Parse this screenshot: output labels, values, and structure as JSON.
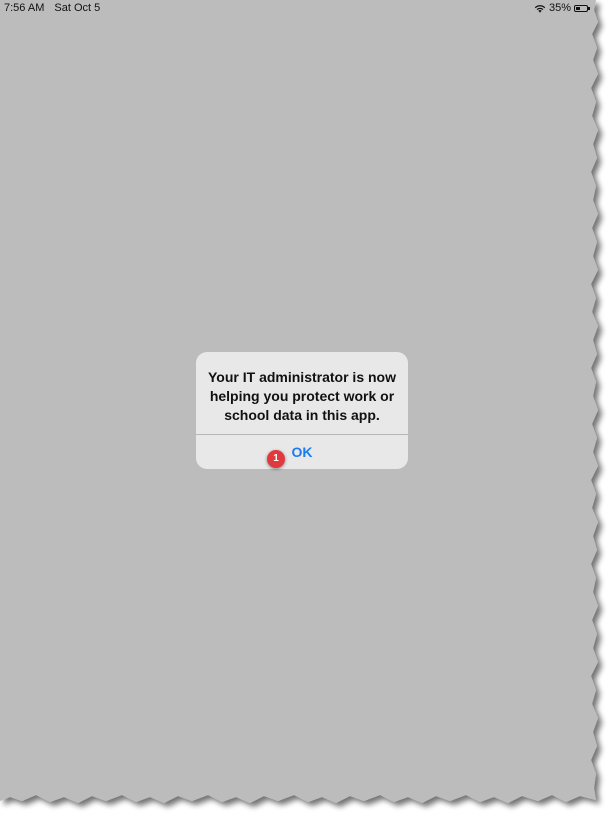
{
  "status_bar": {
    "time": "7:56 AM",
    "date": "Sat Oct 5",
    "battery_text": "35%",
    "battery_level": 0.35
  },
  "alert": {
    "message": "Your IT administrator is now helping you protect work or school data in this app.",
    "ok_label": "OK"
  },
  "callout": {
    "number": "1",
    "color": "#e0393e"
  },
  "colors": {
    "background": "#bcbcbc",
    "alert_background": "#e8e8e8",
    "accent": "#1a7cf5"
  },
  "icons": {
    "wifi": "wifi-icon",
    "battery": "battery-icon"
  }
}
